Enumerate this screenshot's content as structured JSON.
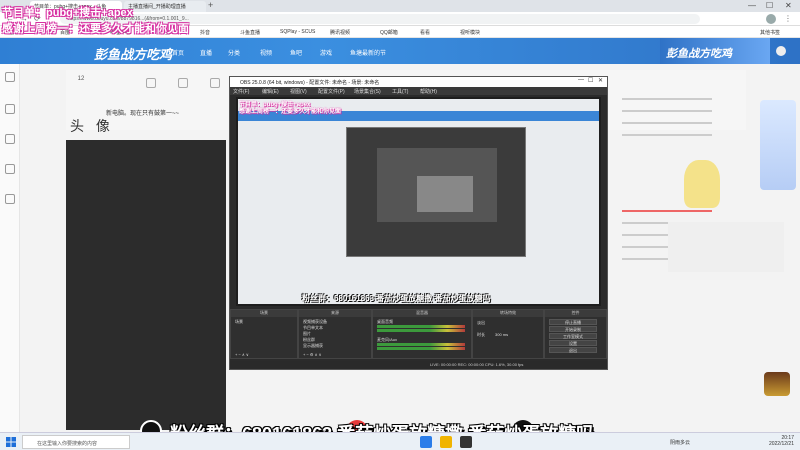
{
  "browser": {
    "tabs": [
      {
        "label": "节目单：pubg+搜击+apex - 斗鱼"
      },
      {
        "label": "主播直播间_开播助理直播"
      }
    ],
    "address": "https://www.douyu.com/8879816...(&from=0.1.001_9...",
    "bookmarks": [
      "应用",
      "百度",
      "哔哩哔哩",
      "淘宝",
      "抖音",
      "斗鱼直播",
      "腾讯视频",
      "QQ邮箱",
      "SQPlay - SCUS",
      "看看",
      "视听模块",
      "其他书签"
    ]
  },
  "site": {
    "logo": "彭鱼战方吃鸡",
    "nav": [
      "首页",
      "直播",
      "分类",
      "视频",
      "鱼吧",
      "游戏",
      "鱼塘最新的节"
    ],
    "profile_stats": [
      "12",
      "",
      "",
      "",
      "",
      ""
    ],
    "nickname": "新电脑。现在只有鼓第一~~",
    "heading": "头 像"
  },
  "overlays": {
    "line1": "节目单：pubg+搜击+apex",
    "line2": "感谢上周榜一：还要多久才能和你见面"
  },
  "obs": {
    "title": "OBS 25.0.8 (64 bit, windows) - 配置文件: 未命名 - 场景: 未命名",
    "menu": [
      "文件(F)",
      "编辑(E)",
      "视图(V)",
      "配置文件(P)",
      "场景集合(S)",
      "工具(T)",
      "帮助(H)"
    ],
    "inner_banner": "粉丝群：680161863  番茄炒蛋放糖撒  番茄炒蛋放糖吗",
    "docks": {
      "scenes_title": "场景",
      "scene_item": "场景",
      "sources_title": "来源",
      "sources": [
        "视频捕获设备",
        "节目单文本",
        "图片",
        "粉丝群",
        "显示器捕获"
      ],
      "mixer_title": "混音器",
      "mixer": [
        "桌面音频",
        "麦克风/Aux"
      ],
      "transitions_title": "转场特效",
      "transition_item": "淡出",
      "duration_label": "时长",
      "duration_value": "300 ms",
      "controls_title": "控件",
      "controls": [
        "停止直播",
        "开始录制",
        "工作室模式",
        "设置",
        "退出"
      ]
    },
    "status": "LIVE: 00:00:00   REC: 00:00:00   CPU: 1.6%, 30.00 fps"
  },
  "banner": {
    "text": "粉丝群：680161863   番茄炒蛋放糖撒   番茄炒蛋放糖吗"
  },
  "taskbar": {
    "search_placeholder": "在这里输入你要搜索的内容",
    "weather": "阴雨多云",
    "time": "20:17",
    "date": "2022/12/21"
  },
  "colors": {
    "site_blue": "#2f7fd4",
    "overlay_pink": "#d62fa0",
    "obs_dark": "#2b2b2b"
  }
}
